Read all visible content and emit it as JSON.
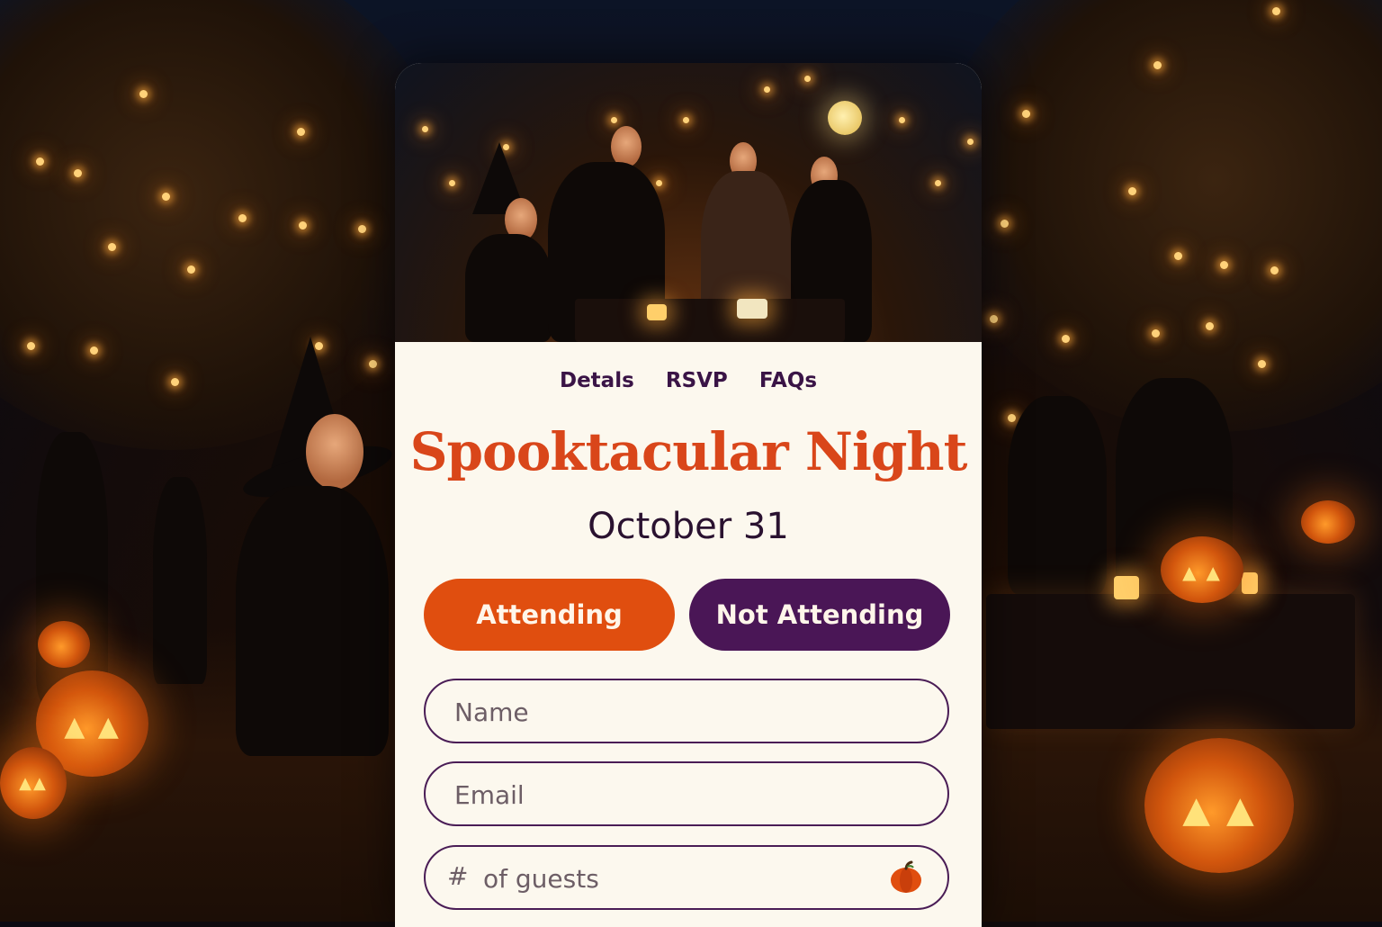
{
  "nav": {
    "items": [
      "Detals",
      "RSVP",
      "FAQs"
    ]
  },
  "event": {
    "title": "Spooktacular Night",
    "date": "October 31"
  },
  "rsvp": {
    "attending_label": "Attending",
    "not_attending_label": "Not Attending"
  },
  "form": {
    "name_placeholder": "Name",
    "email_placeholder": "Email",
    "guests_prefix": "#",
    "guests_placeholder": "of guests",
    "guests_icon": "pumpkin-icon"
  },
  "colors": {
    "accent_orange": "#e04e0f",
    "accent_purple": "#4a1656",
    "title_color": "#d9461a",
    "card_background": "#fcf8ee"
  }
}
